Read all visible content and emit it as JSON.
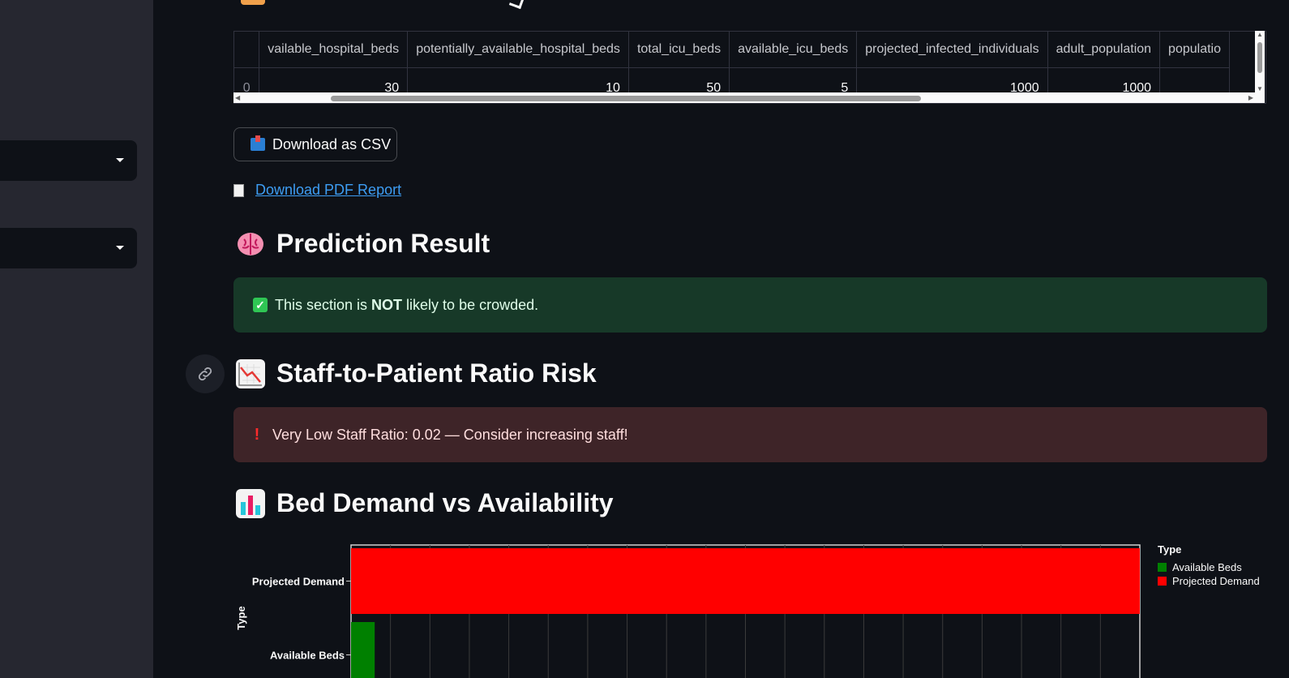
{
  "table": {
    "columns": [
      "",
      "vailable_hospital_beds",
      "potentially_available_hospital_beds",
      "total_icu_beds",
      "available_icu_beds",
      "projected_infected_individuals",
      "adult_population",
      "populatio"
    ],
    "rows": [
      [
        "0",
        "30",
        "10",
        "50",
        "5",
        "1000",
        "1000",
        ""
      ]
    ]
  },
  "download_csv": {
    "label": "Download as CSV",
    "icon": "inbox-tray-icon"
  },
  "pdf_link": {
    "label": "Download PDF Report",
    "icon": "page-icon"
  },
  "prediction": {
    "heading": "Prediction Result",
    "icon": "brain-icon",
    "message_pre": "This section is ",
    "message_bold": "NOT",
    "message_post": " likely to be crowded."
  },
  "staff": {
    "heading": "Staff-to-Patient Ratio Risk",
    "icon": "chart-decreasing-icon",
    "message": "Very Low Staff Ratio: 0.02 — Consider increasing staff!"
  },
  "beds": {
    "heading": "Bed Demand vs Availability",
    "icon": "bar-chart-icon"
  },
  "chart_data": {
    "type": "bar",
    "orientation": "horizontal",
    "categories": [
      "Projected Demand",
      "Available Beds"
    ],
    "values": [
      1000,
      30
    ],
    "colors": [
      "#ff0000",
      "#008000"
    ],
    "ylabel": "Type",
    "legend_title": "Type",
    "legend": [
      {
        "name": "Available Beds",
        "color": "#008000"
      },
      {
        "name": "Projected Demand",
        "color": "#ff0000"
      }
    ],
    "xlim": [
      0,
      1000
    ],
    "legend_position": "right",
    "grid": true
  }
}
